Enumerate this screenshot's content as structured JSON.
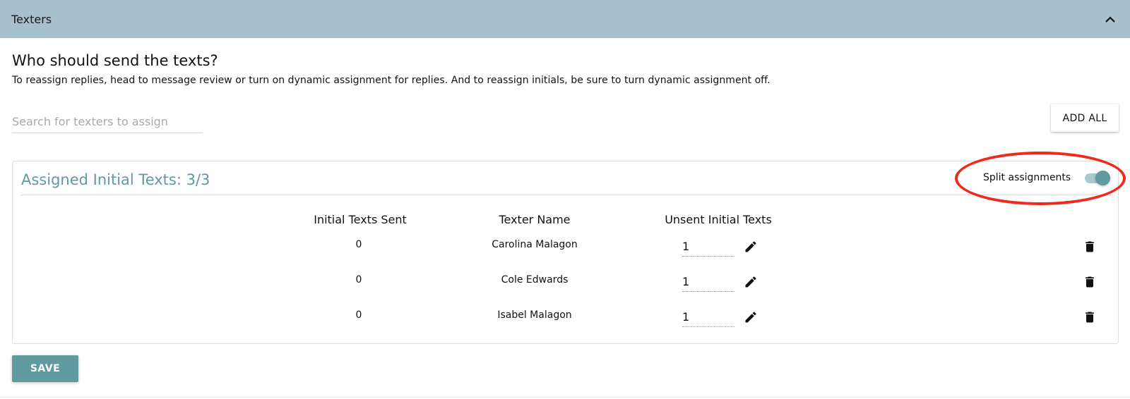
{
  "header": {
    "title": "Texters",
    "collapse_icon": "chevron-up-icon"
  },
  "section": {
    "title": "Who should send the texts?",
    "description": "To reassign replies, head to message review or turn on dynamic assignment for replies. And to reassign initials, be sure to turn dynamic assignment off."
  },
  "search": {
    "placeholder": "Search for texters to assign",
    "value": ""
  },
  "add_all_label": "ADD ALL",
  "assignments": {
    "title": "Assigned Initial Texts: 3/3",
    "split_label": "Split assignments",
    "split_enabled": true,
    "columns": [
      "Initial Texts Sent",
      "Texter Name",
      "Unsent Initial Texts"
    ],
    "rows": [
      {
        "sent": "0",
        "name": "Carolina Malagon",
        "unsent": "1"
      },
      {
        "sent": "0",
        "name": "Cole Edwards",
        "unsent": "1"
      },
      {
        "sent": "0",
        "name": "Isabel Malagon",
        "unsent": "1"
      }
    ]
  },
  "save_label": "SAVE",
  "colors": {
    "header_bg": "#a8bfcd",
    "accent": "#5e9aa0",
    "annotation": "#ee2a1b"
  }
}
